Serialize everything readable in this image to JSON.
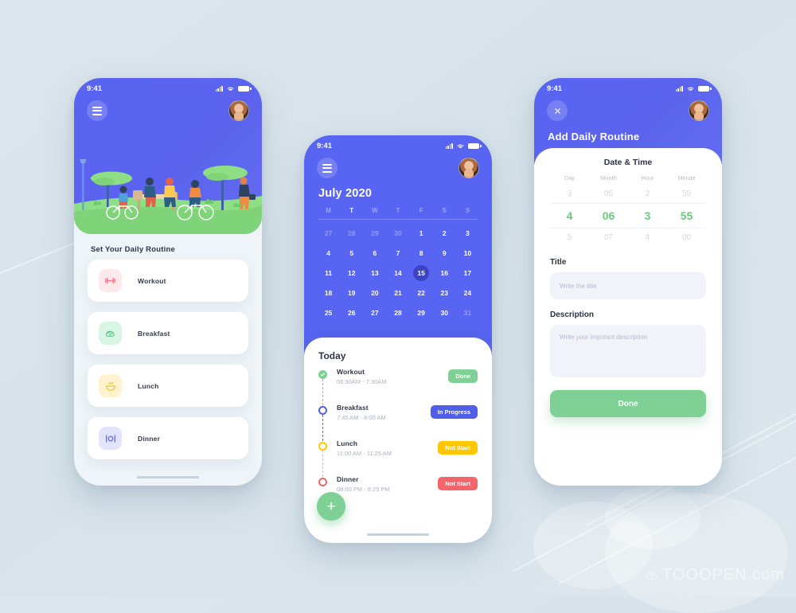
{
  "background": {
    "watermark": "TOOOPEN.com",
    "page_bg": "#dce6ec"
  },
  "status_bar": {
    "time": "9:41",
    "signal_icon": "signal-bars-icon",
    "wifi_icon": "wifi-icon",
    "battery_icon": "battery-icon"
  },
  "colors": {
    "brand_blue": "#5865f2",
    "selected_day": "#3c44c4",
    "green": "#7ED094",
    "picker_green": "#6BC97F",
    "yellow": "#FFC700",
    "red": "#F4646B",
    "muted_text": "#aab1c2"
  },
  "phone1": {
    "menu_icon": "hamburger-menu-icon",
    "avatar_icon": "user-avatar",
    "hero_illustration": "park-scene-illustration",
    "section_title": "Set Your Daily Routine",
    "routines": [
      {
        "label": "Workout",
        "icon": "dumbbell-icon",
        "icon_bg": "#fde8ec",
        "icon_color": "#ef7d8e"
      },
      {
        "label": "Breakfast",
        "icon": "bread-icon",
        "icon_bg": "#d9f5e4",
        "icon_color": "#5fc08c"
      },
      {
        "label": "Lunch",
        "icon": "soup-bowl-icon",
        "icon_bg": "#fdf3cf",
        "icon_color": "#e8c33c"
      },
      {
        "label": "Dinner",
        "icon": "cutlery-icon",
        "icon_bg": "#e3e3fb",
        "icon_color": "#6f6fe0"
      }
    ]
  },
  "phone2": {
    "menu_icon": "hamburger-menu-icon",
    "avatar_icon": "user-avatar",
    "month_title": "July 2020",
    "weekdays": [
      "M",
      "T",
      "W",
      "T",
      "F",
      "S",
      "S"
    ],
    "active_weekday_index": 1,
    "selected_day": 15,
    "days": [
      {
        "n": "27",
        "muted": true
      },
      {
        "n": "28",
        "muted": true
      },
      {
        "n": "29",
        "muted": true
      },
      {
        "n": "30",
        "muted": true
      },
      {
        "n": "1",
        "muted": false
      },
      {
        "n": "2",
        "muted": false
      },
      {
        "n": "3",
        "muted": false
      },
      {
        "n": "4",
        "muted": false
      },
      {
        "n": "5",
        "muted": false
      },
      {
        "n": "6",
        "muted": false
      },
      {
        "n": "7",
        "muted": false
      },
      {
        "n": "8",
        "muted": false
      },
      {
        "n": "9",
        "muted": false
      },
      {
        "n": "10",
        "muted": false
      },
      {
        "n": "11",
        "muted": false
      },
      {
        "n": "12",
        "muted": false
      },
      {
        "n": "13",
        "muted": false
      },
      {
        "n": "14",
        "muted": false
      },
      {
        "n": "15",
        "muted": false,
        "selected": true
      },
      {
        "n": "16",
        "muted": false
      },
      {
        "n": "17",
        "muted": false
      },
      {
        "n": "18",
        "muted": false
      },
      {
        "n": "19",
        "muted": false
      },
      {
        "n": "20",
        "muted": false
      },
      {
        "n": "21",
        "muted": false
      },
      {
        "n": "22",
        "muted": false
      },
      {
        "n": "23",
        "muted": false
      },
      {
        "n": "24",
        "muted": false
      },
      {
        "n": "25",
        "muted": false
      },
      {
        "n": "26",
        "muted": false
      },
      {
        "n": "27",
        "muted": false
      },
      {
        "n": "28",
        "muted": false
      },
      {
        "n": "29",
        "muted": false
      },
      {
        "n": "30",
        "muted": false
      },
      {
        "n": "31",
        "muted": true
      }
    ],
    "today_title": "Today",
    "schedule": [
      {
        "name": "Workout",
        "time": "06:30AM - 7:30AM",
        "status": "Done",
        "status_color": "#7ED094",
        "dot": "check-filled",
        "dot_color": "#7ED094"
      },
      {
        "name": "Breakfast",
        "time": "7:45 AM - 8:00 AM",
        "status": "In Progress",
        "status_color": "#4F5FE8",
        "dot": "ring",
        "dot_color": "#4F5FE8"
      },
      {
        "name": "Lunch",
        "time": "11:00 AM - 11:25 AM",
        "status": "Not Start",
        "status_color": "#FFC700",
        "dot": "ring",
        "dot_color": "#FFC700"
      },
      {
        "name": "Dinner",
        "time": "08:00 PM - 8:25 PM",
        "status": "Not Start",
        "status_color": "#F4646B",
        "dot": "ring",
        "dot_color": "#F4646B"
      }
    ],
    "fab_label": "+",
    "fab_icon": "plus-icon"
  },
  "phone3": {
    "close_icon": "close-icon",
    "avatar_icon": "user-avatar",
    "page_title": "Add Daily Routine",
    "datetime_title": "Date & Time",
    "picker_headers": [
      "Day",
      "Month",
      "Hour",
      "Minute"
    ],
    "picker_prev": [
      "3",
      "05",
      "2",
      "55"
    ],
    "picker_selected": [
      "4",
      "06",
      "3",
      "55"
    ],
    "picker_next": [
      "5",
      "07",
      "4",
      "00"
    ],
    "title_label": "Title",
    "title_placeholder": "Write the title",
    "title_value": "",
    "description_label": "Description",
    "description_placeholder": "Write your impotant description",
    "description_value": "",
    "done_label": "Done"
  }
}
